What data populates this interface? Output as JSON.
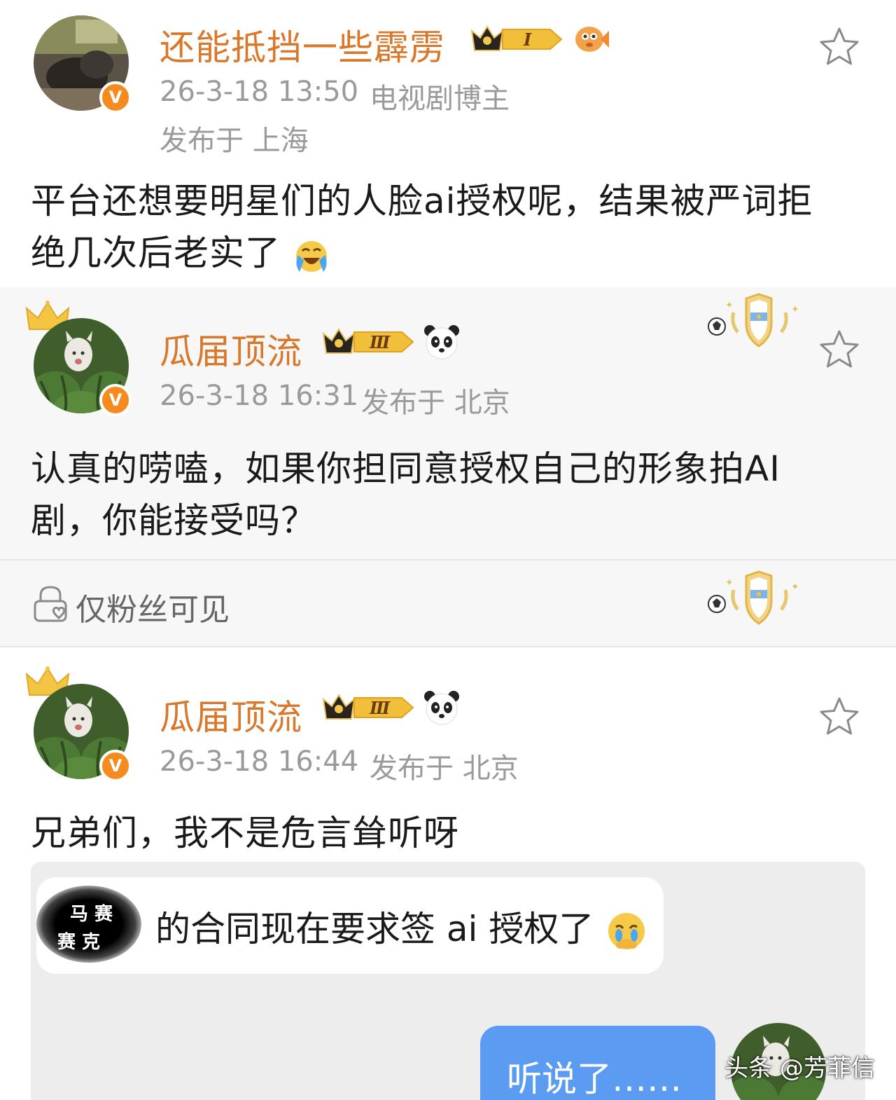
{
  "post1": {
    "username": "还能抵挡一些霹雳",
    "vip_level": "I",
    "timestamp": "26-3-18 13:50",
    "role": "电视剧博主",
    "location": "发布于 上海",
    "content_line1": "平台还想要明星们的人脸ai授权呢，结果被严词拒",
    "content_line2": "绝几次后老实了"
  },
  "post2": {
    "username": "瓜届顶流",
    "vip_level": "Ⅲ",
    "timestamp": "26-3-18 16:31",
    "location": "发布于 北京",
    "content_line1": "认真的唠嗑，如果你担同意授权自己的形象拍AI",
    "content_line2": "剧，你能接受吗？"
  },
  "fans_only": {
    "label": "仅粉丝可见"
  },
  "post3": {
    "username": "瓜届顶流",
    "vip_level": "Ⅲ",
    "timestamp": "26-3-18 16:44",
    "location": "发布于 北京",
    "content": "兄弟们，我不是危言耸听呀",
    "chat": {
      "incoming": "的合同现在要求签 ai 授权了",
      "redacted_line1": "马 赛",
      "redacted_line2": "赛 克",
      "outgoing": "听说了……"
    }
  },
  "watermark": "头条 @芳菲信",
  "colors": {
    "username": "#d9772b",
    "meta": "#9a9a9a",
    "verified_badge": "#f58a1f",
    "chat_bubble_out": "#5b9cf2"
  },
  "icons": {
    "star": "star-outline-icon",
    "lock": "lock-heart-icon",
    "verified": "verified-v-icon"
  }
}
